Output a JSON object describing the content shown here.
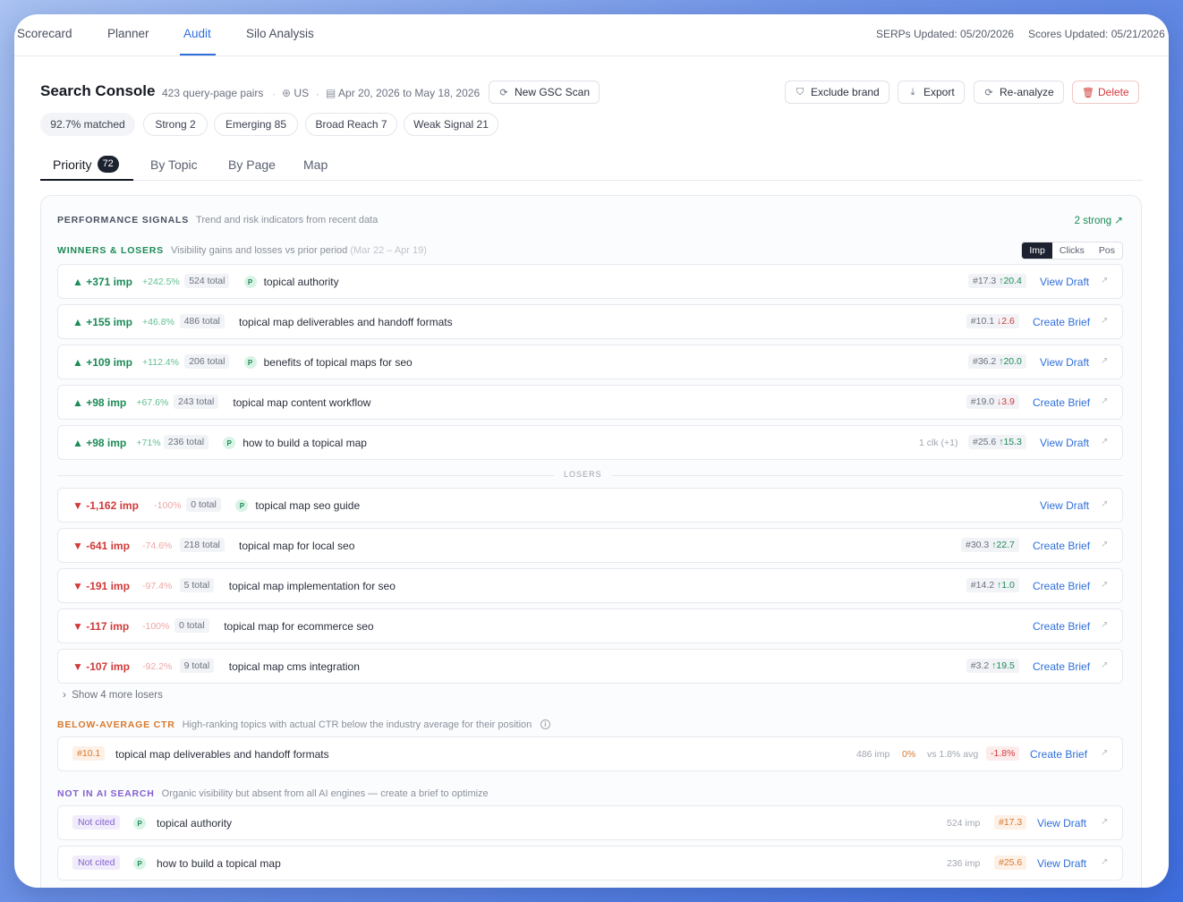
{
  "nav": {
    "tabs": [
      "Scorecard",
      "Planner",
      "Audit",
      "Silo Analysis"
    ],
    "serps_updated": "SERPs Updated: 05/20/2026",
    "scores_updated": "Scores Updated: 05/21/2026"
  },
  "header": {
    "title": "Search Console",
    "pairs": "423 query-page pairs",
    "country": "US",
    "date_range": "Apr 20, 2026 to May 18, 2026",
    "new_scan": "New GSC Scan",
    "exclude_brand": "Exclude brand",
    "export": "Export",
    "reanalyze": "Re-analyze",
    "delete": "Delete"
  },
  "pills": [
    "92.7% matched",
    "Strong 2",
    "Emerging 85",
    "Broad Reach 7",
    "Weak Signal 21"
  ],
  "subtabs": {
    "priority": "Priority",
    "priority_count": "72",
    "by_topic": "By Topic",
    "by_page": "By Page",
    "map": "Map"
  },
  "signals": {
    "title": "PERFORMANCE SIGNALS",
    "desc": "Trend and risk indicators from recent data",
    "strong_link": "2 strong ↗",
    "winners_title": "WINNERS & LOSERS",
    "winners_desc": "Visibility gains and losses vs prior period",
    "winners_period": "(Mar 22 – Apr 19)",
    "seg": [
      "Imp",
      "Clicks",
      "Pos"
    ],
    "losers_label": "LOSERS",
    "show_more": "Show 4 more losers"
  },
  "winners": [
    {
      "delta": "▲ +371 imp",
      "pct": "+242.5%",
      "total": "524 total",
      "p": true,
      "kw": "topical authority",
      "clk": "",
      "pos": "#17.3",
      "chg": "↑20.4",
      "dir": "up",
      "action": "View Draft"
    },
    {
      "delta": "▲ +155 imp",
      "pct": "+46.8%",
      "total": "486 total",
      "p": false,
      "kw": "topical map deliverables and handoff formats",
      "clk": "",
      "pos": "#10.1",
      "chg": "↓2.6",
      "dir": "dn",
      "action": "Create Brief"
    },
    {
      "delta": "▲ +109 imp",
      "pct": "+112.4%",
      "total": "206 total",
      "p": true,
      "kw": "benefits of topical maps for seo",
      "clk": "",
      "pos": "#36.2",
      "chg": "↑20.0",
      "dir": "up",
      "action": "View Draft"
    },
    {
      "delta": "▲ +98 imp",
      "pct": "+67.6%",
      "total": "243 total",
      "p": false,
      "kw": "topical map content workflow",
      "clk": "",
      "pos": "#19.0",
      "chg": "↓3.9",
      "dir": "dn",
      "action": "Create Brief"
    },
    {
      "delta": "▲ +98 imp",
      "pct": "+71%",
      "total": "236 total",
      "p": true,
      "kw": "how to build a topical map",
      "clk": "1 clk (+1)",
      "pos": "#25.6",
      "chg": "↑15.3",
      "dir": "up",
      "action": "View Draft"
    }
  ],
  "losers": [
    {
      "delta": "▼ -1,162 imp",
      "pct": "-100%",
      "total": "0 total",
      "p": true,
      "kw": "topical map seo guide",
      "pos": "",
      "chg": "",
      "dir": "up",
      "action": "View Draft"
    },
    {
      "delta": "▼ -641 imp",
      "pct": "-74.6%",
      "total": "218 total",
      "p": false,
      "kw": "topical map for local seo",
      "pos": "#30.3",
      "chg": "↑22.7",
      "dir": "up",
      "action": "Create Brief"
    },
    {
      "delta": "▼ -191 imp",
      "pct": "-97.4%",
      "total": "5 total",
      "p": false,
      "kw": "topical map implementation for seo",
      "pos": "#14.2",
      "chg": "↑1.0",
      "dir": "up",
      "action": "Create Brief"
    },
    {
      "delta": "▼ -117 imp",
      "pct": "-100%",
      "total": "0 total",
      "p": false,
      "kw": "topical map for ecommerce seo",
      "pos": "",
      "chg": "",
      "dir": "up",
      "action": "Create Brief"
    },
    {
      "delta": "▼ -107 imp",
      "pct": "-92.2%",
      "total": "9 total",
      "p": false,
      "kw": "topical map cms integration",
      "pos": "#3.2",
      "chg": "↑19.5",
      "dir": "up",
      "action": "Create Brief"
    }
  ],
  "ctr": {
    "title": "BELOW-AVERAGE CTR",
    "desc": "High-ranking topics with actual CTR below the industry average for their position",
    "row": {
      "pos": "#10.1",
      "kw": "topical map deliverables and handoff formats",
      "imp": "486 imp",
      "ctr": "0%",
      "avg": "vs 1.8% avg",
      "diff": "-1.8%",
      "action": "Create Brief"
    }
  },
  "ai": {
    "title": "NOT IN AI SEARCH",
    "desc": "Organic visibility but absent from all AI engines — create a brief to optimize",
    "rows": [
      {
        "badge": "Not cited",
        "kw": "topical authority",
        "imp": "524 imp",
        "pos": "#17.3",
        "action": "View Draft"
      },
      {
        "badge": "Not cited",
        "kw": "how to build a topical map",
        "imp": "236 imp",
        "pos": "#25.6",
        "action": "View Draft"
      }
    ]
  },
  "colors": {
    "accent": "#2f6fdb",
    "up": "#1c8a56",
    "down": "#d13a3a",
    "orange": "#d9782c",
    "purple": "#8460cf"
  }
}
